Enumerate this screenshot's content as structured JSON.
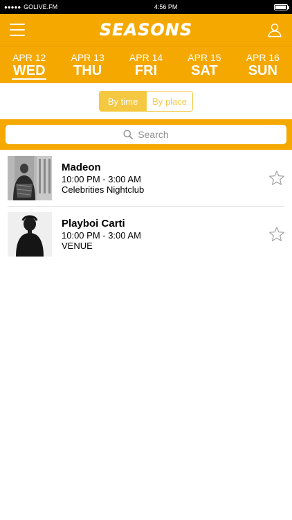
{
  "status_bar": {
    "signal": "●●●●●",
    "carrier": "GOLIVE.FM",
    "time": "4:56 PM",
    "battery_level": 0.95
  },
  "header": {
    "logo": "SEASONS",
    "menu_icon": "hamburger-menu-icon",
    "profile_icon": "user-profile-icon",
    "accent_color": "#f5a800"
  },
  "date_tabs": [
    {
      "date": "APR 12",
      "day": "WED",
      "active": true
    },
    {
      "date": "APR 13",
      "day": "THU",
      "active": false
    },
    {
      "date": "APR 14",
      "day": "FRI",
      "active": false
    },
    {
      "date": "APR 15",
      "day": "SAT",
      "active": false
    },
    {
      "date": "APR 16",
      "day": "SUN",
      "active": false
    }
  ],
  "view_toggle": {
    "by_time": "By time",
    "by_place": "By place",
    "selected": "By time"
  },
  "search": {
    "placeholder": "Search",
    "icon": "search-icon"
  },
  "events": [
    {
      "name": "Madeon",
      "time": "10:00 PM - 3:00 AM",
      "venue": "Celebrities Nightclub",
      "favorited": false
    },
    {
      "name": "Playboi Carti",
      "time": "10:00 PM - 3:00 AM",
      "venue": "VENUE",
      "favorited": false
    }
  ]
}
